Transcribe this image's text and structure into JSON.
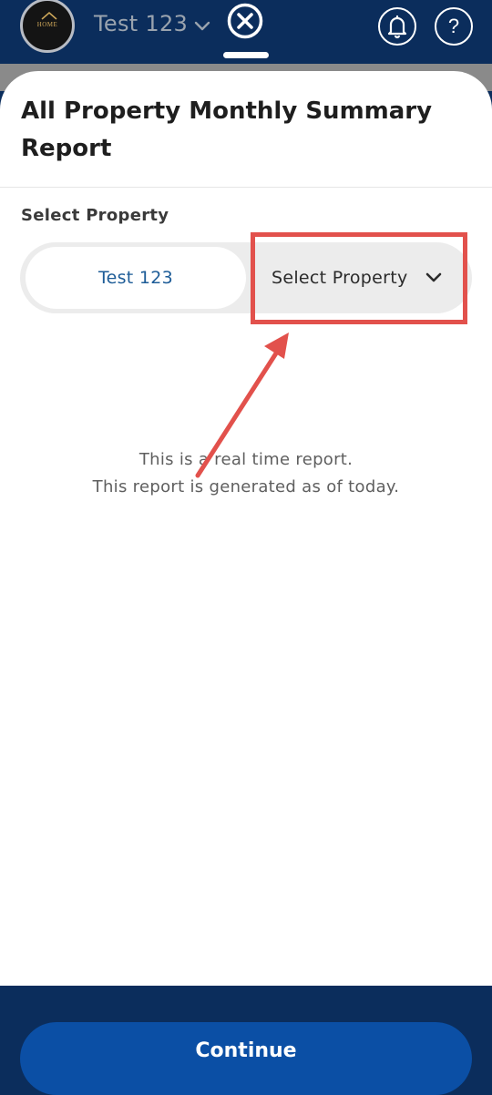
{
  "header": {
    "account_name": "Test 123",
    "logo_text": "HOME",
    "help_glyph": "?",
    "icons": [
      "chevron-down-icon",
      "close-icon",
      "bell-icon",
      "help-icon"
    ]
  },
  "sheet": {
    "title": "All Property Monthly Summary Report",
    "select_label": "Select Property",
    "selected_property": "Test 123",
    "dropdown_label": "Select Property",
    "info_line1": "This is a real time report.",
    "info_line2": "This report is generated as of today.",
    "continue_label": "Continue"
  },
  "colors": {
    "header_bg": "#0b2d5c",
    "primary_button": "#0b4fa5",
    "selected_text": "#1d5c97",
    "annotation": "#e2514c"
  }
}
